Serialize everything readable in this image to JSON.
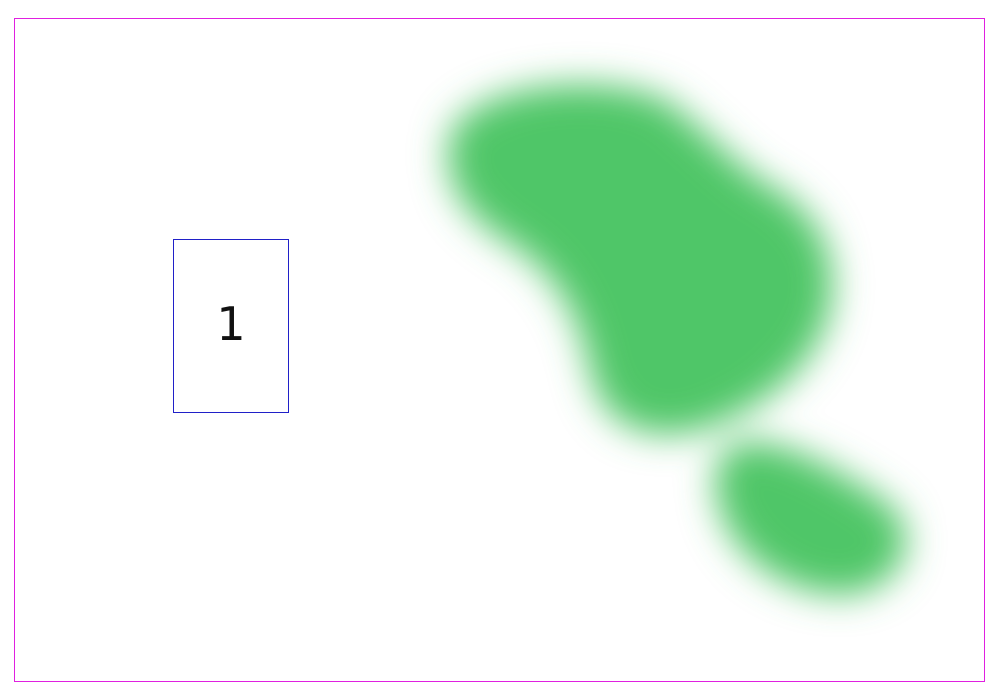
{
  "canvas": {
    "frame_color": "#e020e0",
    "blob_color": "#50c668"
  },
  "marker": {
    "label": "1",
    "border_color": "#2020c8"
  }
}
